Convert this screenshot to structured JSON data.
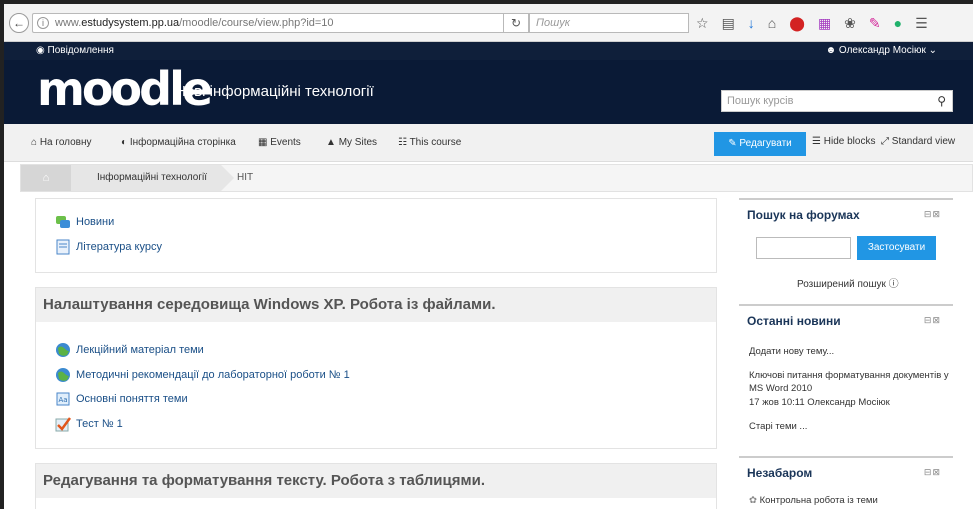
{
  "browser": {
    "url_prefix": "www.",
    "url_domain": "estudysystem.pp.ua",
    "url_path": "/moodle/course/view.php?id=10",
    "search_placeholder": "Пошук"
  },
  "navbar": {
    "messages_label": "Повідомлення",
    "user_name": "Олександр Мосіюк"
  },
  "header": {
    "logo_text": "moodle",
    "site_name": "Нові інформаційні технології",
    "course_search_placeholder": "Пошук курсів"
  },
  "menu": {
    "items": [
      {
        "label": "На головну",
        "icon": "home-icon"
      },
      {
        "label": "Інформаційна сторінка",
        "icon": "gauge-icon"
      },
      {
        "label": "Events",
        "icon": "calendar-icon"
      },
      {
        "label": "My Sites",
        "icon": "graduation-cap-icon"
      },
      {
        "label": "This course",
        "icon": "sitemap-icon"
      }
    ],
    "edit_button": "Редагувати",
    "hide_blocks": "Hide blocks",
    "standard_view": "Standard view"
  },
  "breadcrumb": {
    "items": [
      "Інформаційні технології",
      "НІТ"
    ]
  },
  "sections": [
    {
      "title": "",
      "activities": [
        {
          "label": "Новини",
          "icon": "forum-icon"
        },
        {
          "label": "Література курсу",
          "icon": "page-icon"
        }
      ]
    },
    {
      "title": "Налаштування середовища Windows XP. Робота із файлами.",
      "activities": [
        {
          "label": "Лекційний матеріал теми",
          "icon": "url-globe-icon"
        },
        {
          "label": "Методичні рекомендації до лабораторної роботи № 1",
          "icon": "url-globe-icon"
        },
        {
          "label": "Основні поняття теми",
          "icon": "glossary-icon"
        },
        {
          "label": "Тест № 1",
          "icon": "quiz-check-icon"
        }
      ]
    },
    {
      "title": "Редагування та форматування тексту. Робота з таблицями.",
      "activities": []
    }
  ],
  "blocks": {
    "forum_search": {
      "title": "Пошук на форумах",
      "button": "Застосувати",
      "advanced": "Розширений пошук"
    },
    "latest_news": {
      "title": "Останні новини",
      "add_topic": "Додати нову тему...",
      "news_title_line1": "Ключові питання форматування документів у",
      "news_title_line2": "MS Word 2010",
      "news_meta": "17 жов 10:11  Олександр Мосіюк",
      "older": "Старі теми ..."
    },
    "upcoming": {
      "title": "Незабаром",
      "item": "Контрольна робота із теми"
    }
  },
  "colors": {
    "header_bg": "#0a1a36",
    "accent_blue": "#2196e4",
    "link": "#1a4f87"
  }
}
